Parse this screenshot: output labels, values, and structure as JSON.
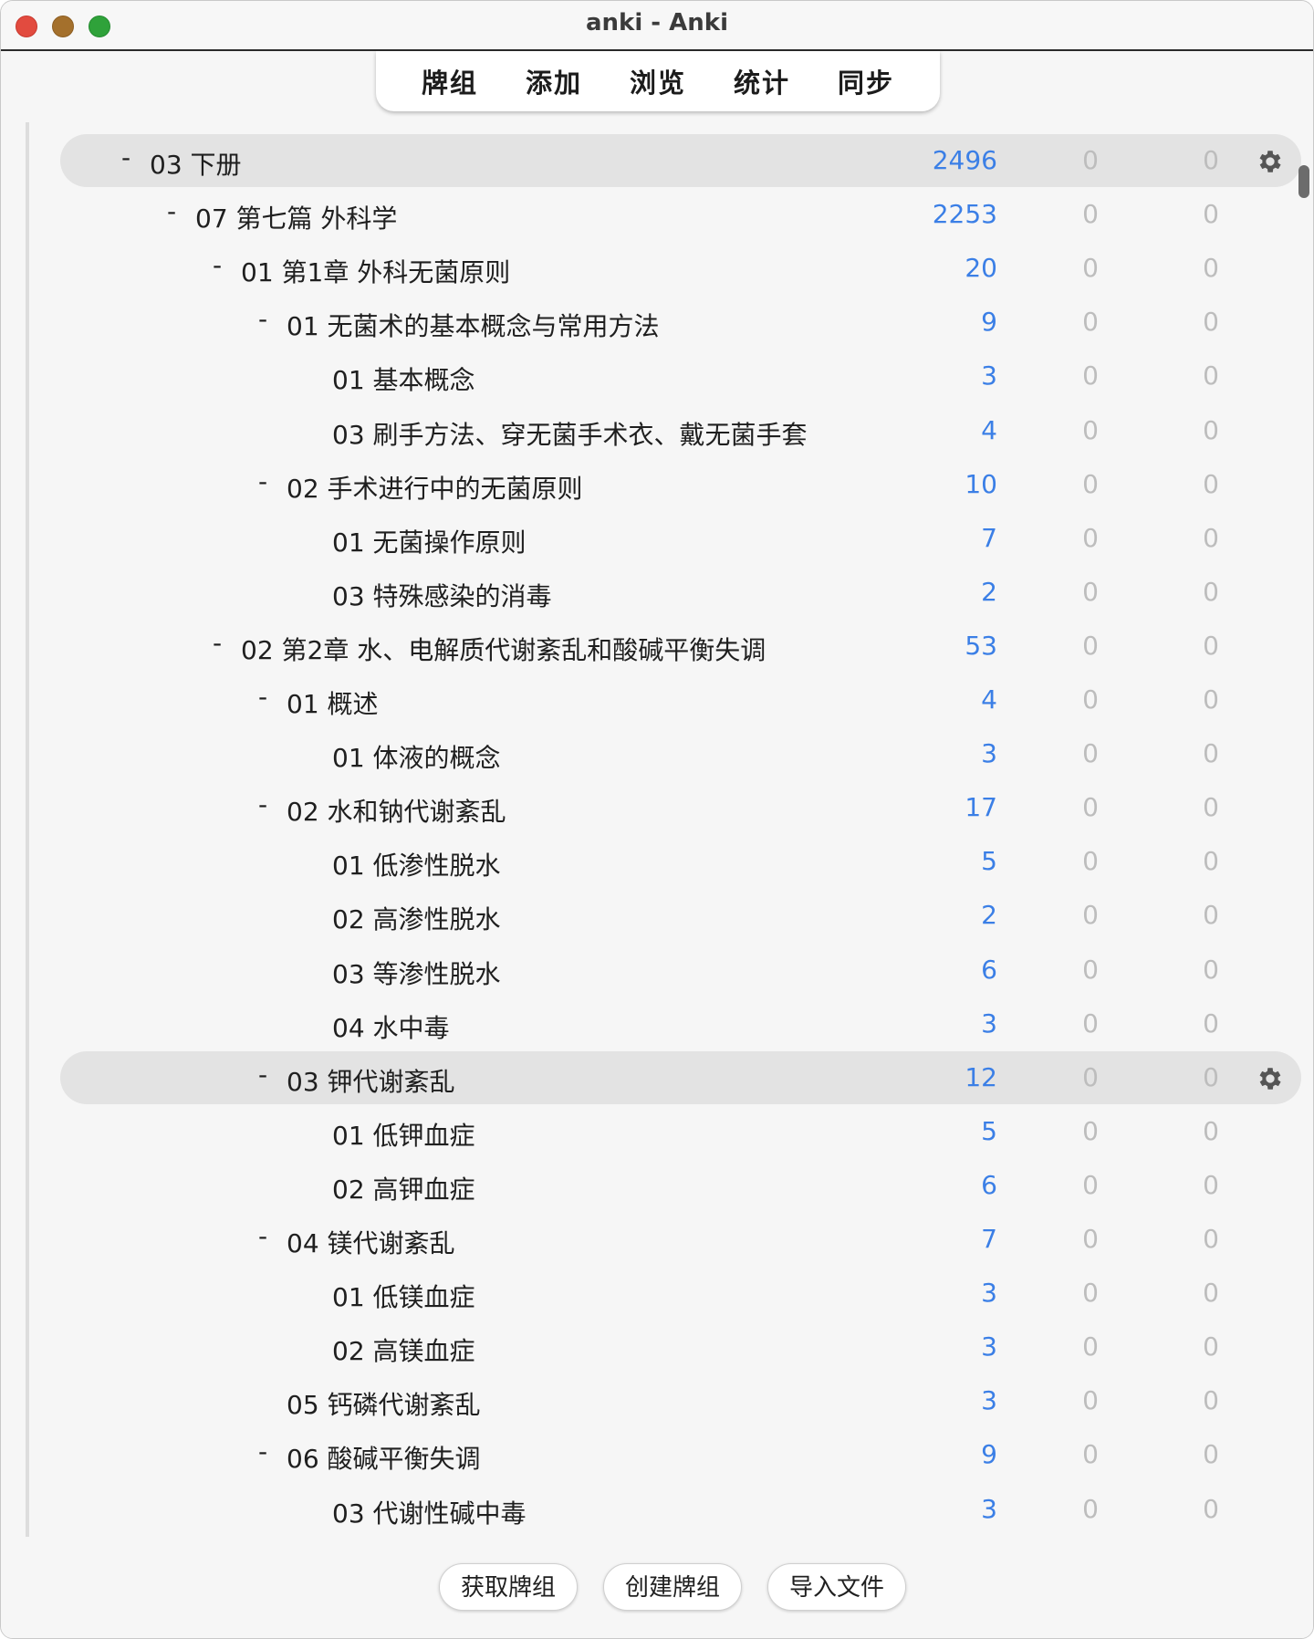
{
  "window": {
    "title": "anki - Anki"
  },
  "toolbar": {
    "items": [
      "牌组",
      "添加",
      "浏览",
      "统计",
      "同步"
    ]
  },
  "decks": [
    {
      "name": "03 下册",
      "collapse": "-",
      "due": "2496",
      "learn": "0",
      "new": "0",
      "level": 0,
      "selected": true,
      "gear": true
    },
    {
      "name": "07 第七篇 外科学",
      "collapse": "-",
      "due": "2253",
      "learn": "0",
      "new": "0",
      "level": 1
    },
    {
      "name": "01 第1章 外科无菌原则",
      "collapse": "-",
      "due": "20",
      "learn": "0",
      "new": "0",
      "level": 2
    },
    {
      "name": "01 无菌术的基本概念与常用方法",
      "collapse": "-",
      "due": "9",
      "learn": "0",
      "new": "0",
      "level": 3
    },
    {
      "name": "01 基本概念",
      "collapse": "",
      "due": "3",
      "learn": "0",
      "new": "0",
      "level": 4
    },
    {
      "name": "03 刷手方法、穿无菌手术衣、戴无菌手套",
      "collapse": "",
      "due": "4",
      "learn": "0",
      "new": "0",
      "level": 4
    },
    {
      "name": "02 手术进行中的无菌原则",
      "collapse": "-",
      "due": "10",
      "learn": "0",
      "new": "0",
      "level": 3
    },
    {
      "name": "01 无菌操作原则",
      "collapse": "",
      "due": "7",
      "learn": "0",
      "new": "0",
      "level": 4
    },
    {
      "name": "03 特殊感染的消毒",
      "collapse": "",
      "due": "2",
      "learn": "0",
      "new": "0",
      "level": 4
    },
    {
      "name": "02 第2章 水、电解质代谢紊乱和酸碱平衡失调",
      "collapse": "-",
      "due": "53",
      "learn": "0",
      "new": "0",
      "level": 2
    },
    {
      "name": "01 概述",
      "collapse": "-",
      "due": "4",
      "learn": "0",
      "new": "0",
      "level": 3
    },
    {
      "name": "01 体液的概念",
      "collapse": "",
      "due": "3",
      "learn": "0",
      "new": "0",
      "level": 4
    },
    {
      "name": "02 水和钠代谢紊乱",
      "collapse": "-",
      "due": "17",
      "learn": "0",
      "new": "0",
      "level": 3
    },
    {
      "name": "01 低渗性脱水",
      "collapse": "",
      "due": "5",
      "learn": "0",
      "new": "0",
      "level": 4
    },
    {
      "name": "02 高渗性脱水",
      "collapse": "",
      "due": "2",
      "learn": "0",
      "new": "0",
      "level": 4
    },
    {
      "name": "03 等渗性脱水",
      "collapse": "",
      "due": "6",
      "learn": "0",
      "new": "0",
      "level": 4
    },
    {
      "name": "04 水中毒",
      "collapse": "",
      "due": "3",
      "learn": "0",
      "new": "0",
      "level": 4
    },
    {
      "name": "03 钾代谢紊乱",
      "collapse": "-",
      "due": "12",
      "learn": "0",
      "new": "0",
      "level": 3,
      "selected": true,
      "gear": true
    },
    {
      "name": "01 低钾血症",
      "collapse": "",
      "due": "5",
      "learn": "0",
      "new": "0",
      "level": 4
    },
    {
      "name": "02 高钾血症",
      "collapse": "",
      "due": "6",
      "learn": "0",
      "new": "0",
      "level": 4
    },
    {
      "name": "04 镁代谢紊乱",
      "collapse": "-",
      "due": "7",
      "learn": "0",
      "new": "0",
      "level": 3
    },
    {
      "name": "01 低镁血症",
      "collapse": "",
      "due": "3",
      "learn": "0",
      "new": "0",
      "level": 4
    },
    {
      "name": "02 高镁血症",
      "collapse": "",
      "due": "3",
      "learn": "0",
      "new": "0",
      "level": 4
    },
    {
      "name": "05 钙磷代谢紊乱",
      "collapse": "",
      "due": "3",
      "learn": "0",
      "new": "0",
      "level": 3
    },
    {
      "name": "06 酸碱平衡失调",
      "collapse": "-",
      "due": "9",
      "learn": "0",
      "new": "0",
      "level": 3
    },
    {
      "name": "03 代谢性碱中毒",
      "collapse": "",
      "due": "3",
      "learn": "0",
      "new": "0",
      "level": 4
    }
  ],
  "bottom": {
    "get_shared": "获取牌组",
    "create_deck": "创建牌组",
    "import_file": "导入文件"
  },
  "colors": {
    "due": "#3b7fe6",
    "zero": "#bdbdbd",
    "selected_row": "#e3e3e3"
  },
  "icons": {
    "row_options": "gear-icon"
  }
}
